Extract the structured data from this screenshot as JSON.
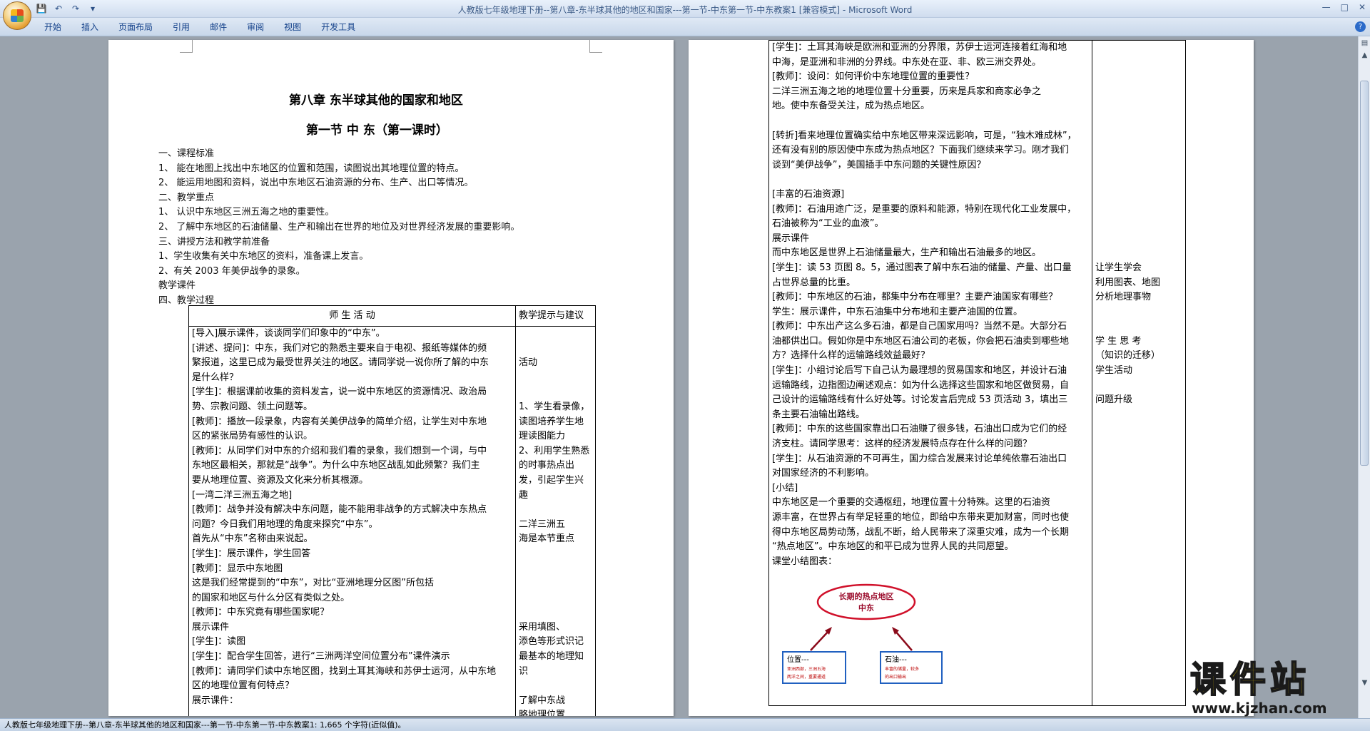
{
  "window": {
    "title": "人教版七年级地理下册--第八章-东半球其他的地区和国家---第一节-中东第一节-中东教案1 [兼容模式] - Microsoft Word"
  },
  "ribbon": {
    "tabs": [
      "开始",
      "插入",
      "页面布局",
      "引用",
      "邮件",
      "审阅",
      "视图",
      "开发工具"
    ]
  },
  "left_page": {
    "title": "第八章  东半球其他的国家和地区",
    "subtitle": "第一节  中  东（第一课时）",
    "paras": [
      "一、课程标准",
      "1、  能在地图上找出中东地区的位置和范围，读图说出其地理位置的特点。",
      "2、  能运用地图和资料，说出中东地区石油资源的分布、生产、出口等情况。",
      "二、教学重点",
      "1、  认识中东地区三洲五海之地的重要性。",
      "2、  了解中东地区的石油储量、生产和输出在世界的地位及对世界经济发展的重要影响。",
      "三、讲授方法和教学前准备",
      "1、学生收集有关中东地区的资料，准备课上发言。",
      "2、有关 2003 年美伊战争的录象。",
      "教学课件",
      "四、教学过程"
    ],
    "table": {
      "header_activity": "师  生  活  动",
      "header_hint": "教学提示与建议",
      "activity_lines": [
        "[导入]展示课件，谈谈同学们印象中的“中东”。",
        "[讲述、提问]：中东，我们对它的熟悉主要来自于电视、报纸等媒体的频",
        "繁报道，这里已成为最受世界关注的地区。请同学说一说你所了解的中东",
        "是什么样？",
        "[学生]：根据课前收集的资料发言，说一说中东地区的资源情况、政治局",
        "势、宗教问题、领土问题等。",
        "[教师]：播放一段录象，内容有关美伊战争的简单介绍，让学生对中东地",
        "区的紧张局势有感性的认识。",
        "[教师]：从同学们对中东的介绍和我们看的录象，我们想到一个词，与中",
        "东地区最相关，那就是“战争”。为什么中东地区战乱如此频繁？我们主",
        "要从地理位置、资源及文化来分析其根源。",
        "[一湾二洋三洲五海之地]",
        "[教师]：战争并没有解决中东问题，能不能用非战争的方式解决中东热点",
        "问题？今日我们用地理的角度来探究“中东”。",
        "      首先从“中东”名称由来说起。",
        "[学生]：展示课件，学生回答",
        "[教师]：显示中东地图",
        "        这是我们经常提到的“中东”，对比“亚洲地理分区图”所包括",
        "的国家和地区与什么分区有类似之处。",
        "[教师]：中东究竟有哪些国家呢？",
        "展示课件",
        "[学生]：读图",
        "[学生]：配合学生回答，进行“三洲两洋空间位置分布”课件演示",
        "[教师]：请同学们读中东地区图，找到土耳其海峡和苏伊士运河，从中东地",
        "区的地理位置有何特点？",
        "展示课件："
      ],
      "hint_lines": [
        "",
        "",
        "活动",
        "",
        "",
        "1、学生看录像，",
        "读图培养学生地",
        "理读图能力",
        "2、利用学生熟悉",
        "的时事热点出",
        "发，引起学生兴",
        "趣",
        "",
        "    二洋三洲五",
        "海是本节重点",
        "",
        "",
        "",
        "",
        "",
        "    采用填图、",
        "添色等形式识记",
        "最基本的地理知",
        "识",
        "",
        "    了解中东战",
        "略地理位置"
      ]
    }
  },
  "right_page": {
    "activity_lines": [
      "[学生]：土耳其海峡是欧洲和亚洲的分界限，苏伊士运河连接着红海和地",
      "中海，是亚洲和非洲的分界线。中东处在亚、非、欧三洲交界处。",
      "[教师]：设问：如何评价中东地理位置的重要性？",
      "      二洋三洲五海之地的地理位置十分重要，历来是兵家和商家必争之",
      "地。使中东备受关注，成为热点地区。",
      "",
      "[转折]看来地理位置确实给中东地区带来深远影响，可是，“独木难成林”，",
      "还有没有别的原因使中东成为热点地区？下面我们继续来学习。刚才我们",
      "谈到“美伊战争”，美国插手中东问题的关键性原因？",
      "",
      "[丰富的石油资源]",
      "[教师]：石油用途广泛，是重要的原料和能源，特别在现代化工业发展中，",
      "石油被称为“工业的血液”。",
      "展示课件",
      "      而中东地区是世界上石油储量最大，生产和输出石油最多的地区。",
      "[学生]：读 53 页图 8。5，通过图表了解中东石油的储量、产量、出口量",
      "占世界总量的比重。",
      "[教师]：中东地区的石油，都集中分布在哪里？主要产油国家有哪些？",
      "学生：展示课件，中东石油集中分布地和主要产油国的位置。",
      "[教师]：中东出产这么多石油，都是自己国家用吗？当然不是。大部分石",
      "油都供出口。假如你是中东地区石油公司的老板，你会把石油卖到哪些地",
      "方？选择什么样的运输路线效益最好？",
      "[学生]：小组讨论后写下自己认为最理想的贸易国家和地区，并设计石油",
      "运输路线，边指图边阐述观点：如为什么选择这些国家和地区做贸易，自",
      "己设计的运输路线有什么好处等。讨论发言后完成 53 页活动 3，填出三",
      "条主要石油输出路线。",
      "[教师]：中东的这些国家靠出口石油赚了很多钱，石油出口成为它们的经",
      "济支柱。请同学思考：这样的经济发展特点存在什么样的问题？",
      "[学生]：从石油资源的不可再生，国力综合发展来讨论单纯依靠石油出口",
      "对国家经济的不利影响。",
      "[小结]",
      "      中东地区是一个重要的交通枢纽，地理位置十分特殊。这里的石油资",
      "源丰富，在世界占有举足轻重的地位，即给中东带来更加财富，同时也使",
      "得中东地区局势动荡，战乱不断，给人民带来了深重灾难，成为一个长期",
      "“热点地区”。中东地区的和平已成为世界人民的共同愿望。",
      "      课堂小结图表："
    ],
    "hint_lines": [
      "",
      "",
      "",
      "",
      "",
      "",
      "",
      "",
      "",
      "",
      "",
      "",
      "",
      "",
      "",
      "  让学生学会",
      "利用图表、地图",
      "分析地理事物",
      "",
      "",
      "  学 生 思 考",
      "（知识的迁移）",
      "  学生活动",
      "",
      "  问题升级",
      ""
    ],
    "diagram": {
      "center_line1": "长期的热点地区",
      "center_line2": "中东",
      "left_title": "位置---",
      "left_line1": "亚洲西部，三洲五海",
      "left_line2": "两洋之间，重要通道",
      "right_title": "石油---",
      "right_line1": "丰富的储量，较多",
      "right_line2": "的出口输出"
    }
  },
  "status_bar": {
    "text": "人教版七年级地理下册--第八章-东半球其他的地区和国家---第一节-中东第一节-中东教案1: 1,665 个字符(近似值)。"
  },
  "watermark": {
    "brand": "课件站",
    "url": "www.kjzhan.com"
  },
  "colors": {
    "accent": "#15428b",
    "diagram_red": "#d0102a",
    "diagram_blue": "#2060c0",
    "watermark_yellow": "#f5d500"
  }
}
